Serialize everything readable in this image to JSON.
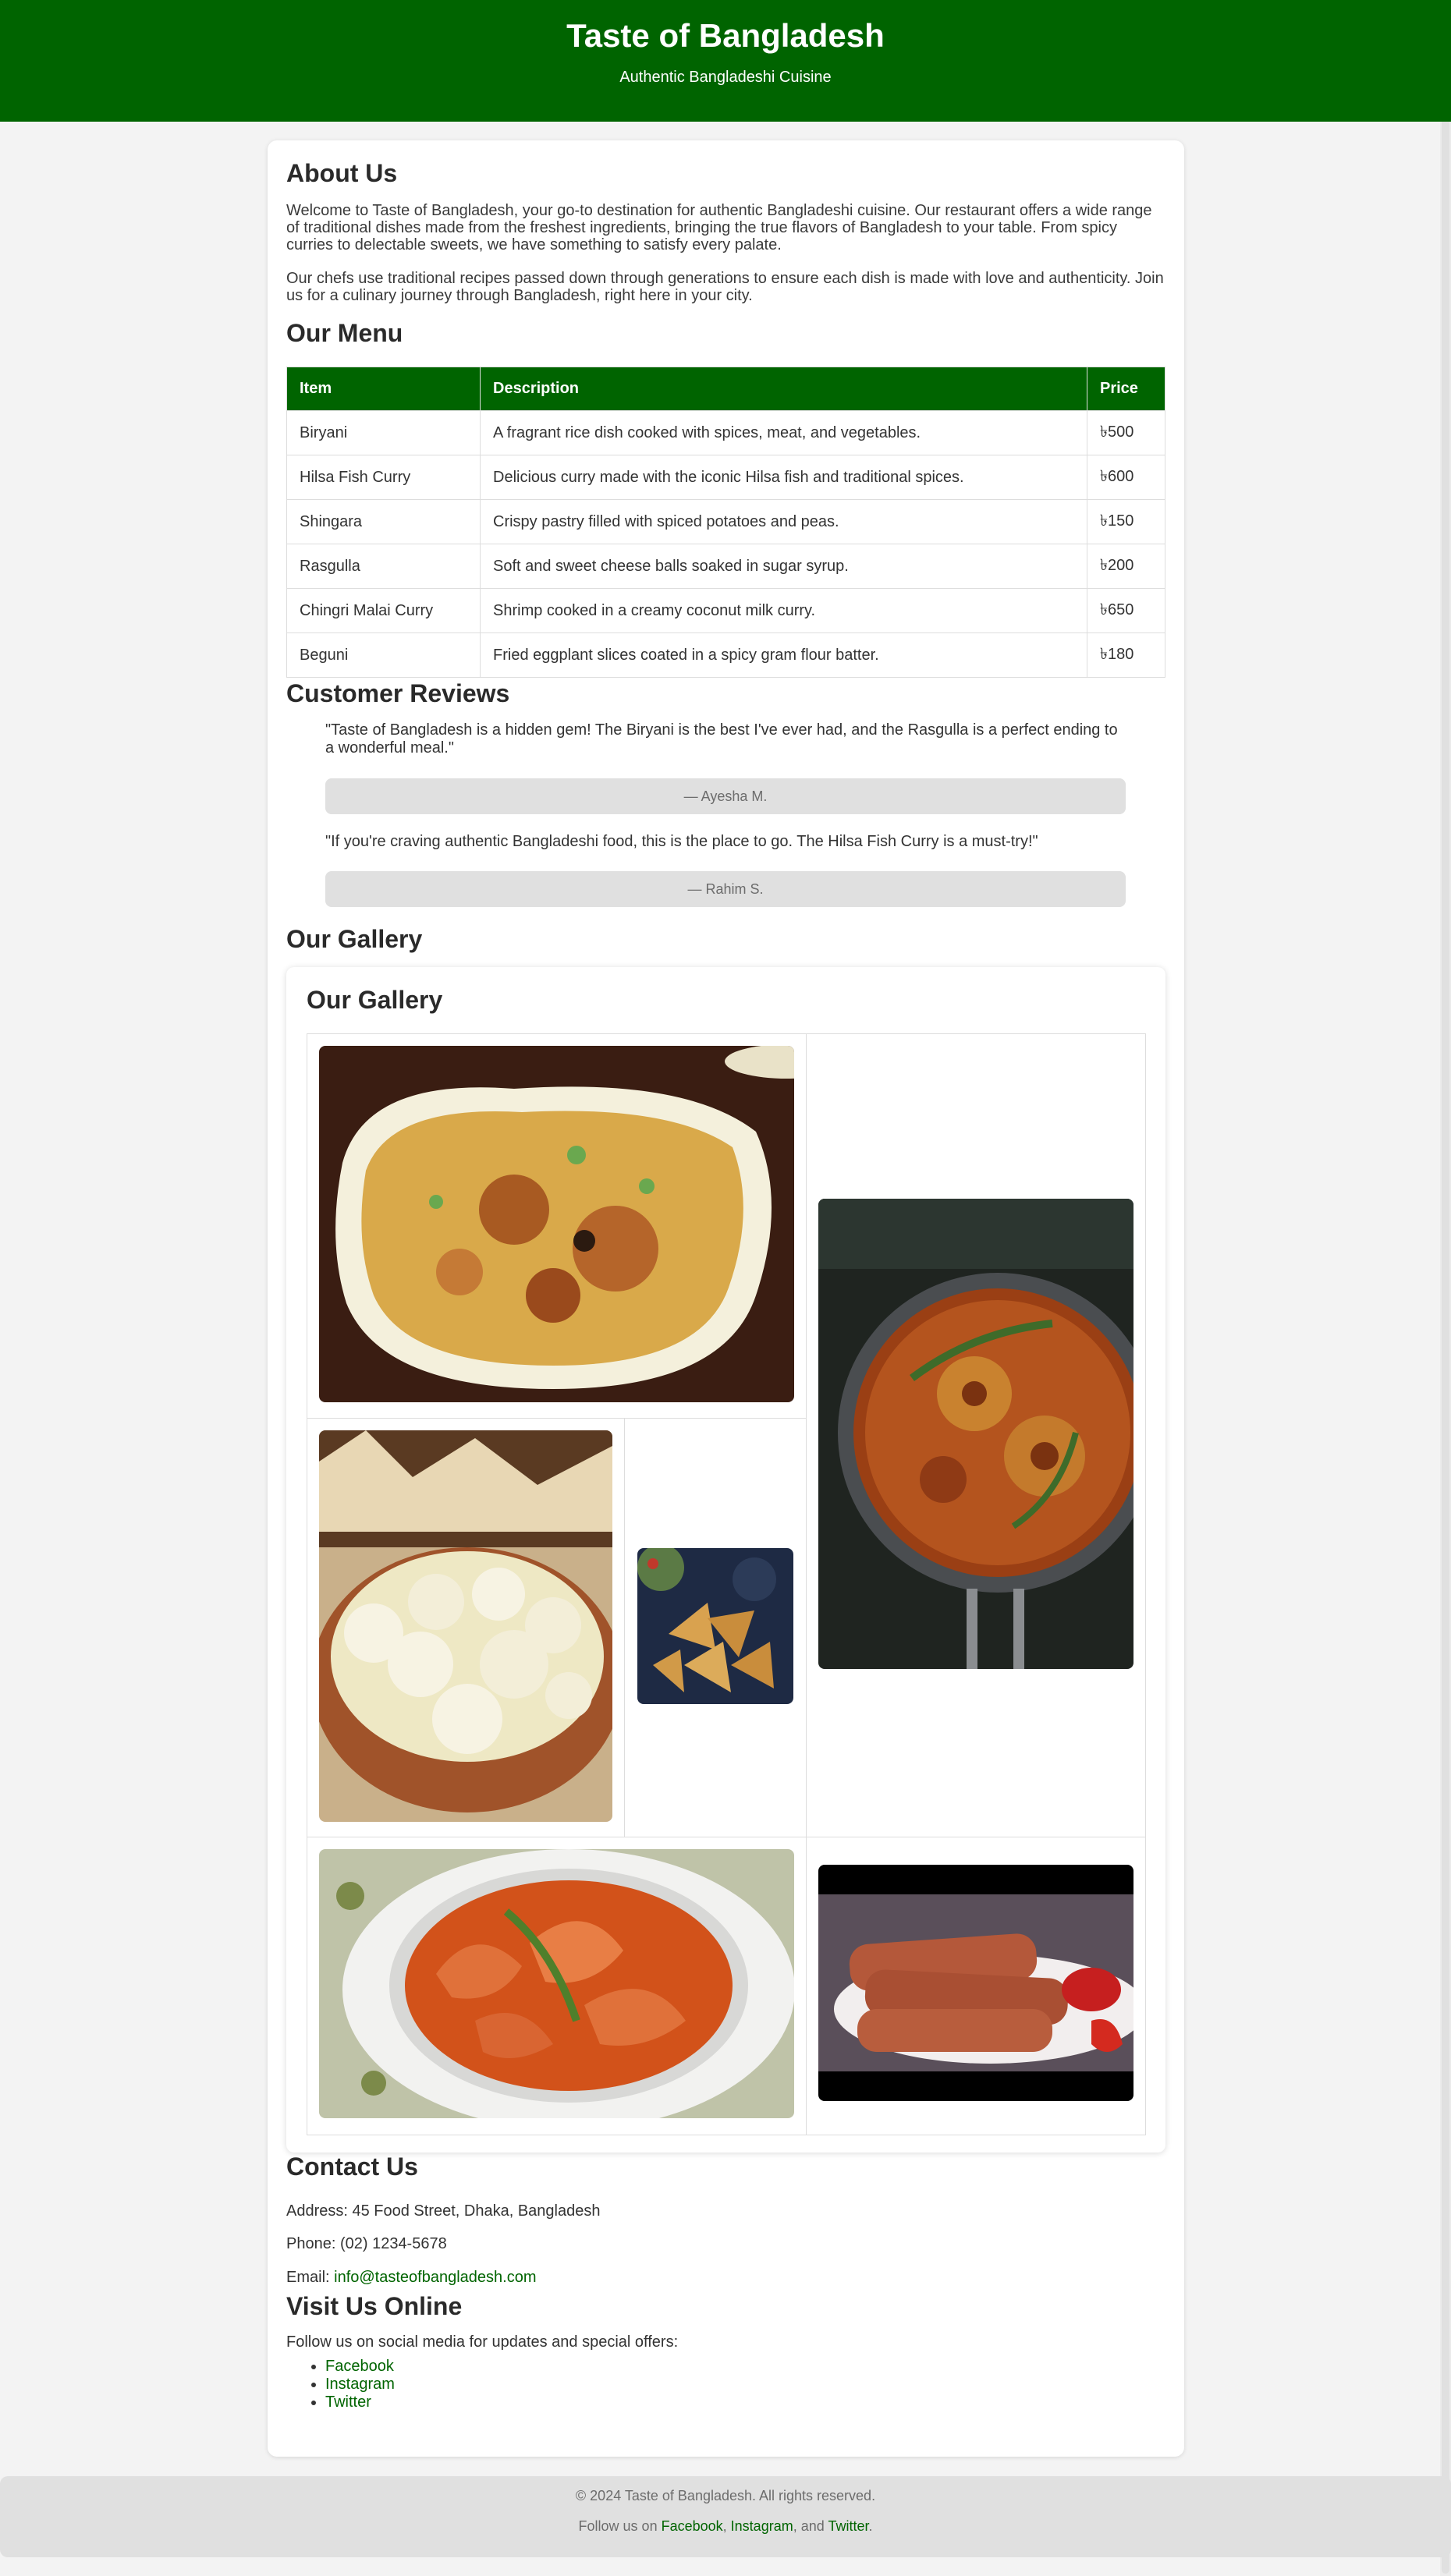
{
  "header": {
    "title": "Taste of Bangladesh",
    "tagline": "Authentic Bangladeshi Cuisine"
  },
  "about": {
    "heading": "About Us",
    "paragraph1": "Welcome to Taste of Bangladesh, your go-to destination for authentic Bangladeshi cuisine. Our restaurant offers a wide range of traditional dishes made from the freshest ingredients, bringing the true flavors of Bangladesh to your table. From spicy curries to delectable sweets, we have something to satisfy every palate.",
    "paragraph2": "Our chefs use traditional recipes passed down through generations to ensure each dish is made with love and authenticity. Join us for a culinary journey through Bangladesh, right here in your city."
  },
  "menu": {
    "heading": "Our Menu",
    "columns": [
      "Item",
      "Description",
      "Price"
    ],
    "rows": [
      [
        "Biryani",
        "A fragrant rice dish cooked with spices, meat, and vegetables.",
        "৳500"
      ],
      [
        "Hilsa Fish Curry",
        "Delicious curry made with the iconic Hilsa fish and traditional spices.",
        "৳600"
      ],
      [
        "Shingara",
        "Crispy pastry filled with spiced potatoes and peas.",
        "৳150"
      ],
      [
        "Rasgulla",
        "Soft and sweet cheese balls soaked in sugar syrup.",
        "৳200"
      ],
      [
        "Chingri Malai Curry",
        "Shrimp cooked in a creamy coconut milk curry.",
        "৳650"
      ],
      [
        "Beguni",
        "Fried eggplant slices coated in a spicy gram flour batter.",
        "৳180"
      ]
    ]
  },
  "reviews": {
    "heading": "Customer Reviews",
    "items": [
      {
        "text": "\"Taste of Bangladesh is a hidden gem! The Biryani is the best I've ever had, and the Rasgulla is a perfect ending to a wonderful meal.\"",
        "author": "— Ayesha M."
      },
      {
        "text": "\"If you're craving authentic Bangladeshi food, this is the place to go. The Hilsa Fish Curry is a must-try!\"",
        "author": "— Rahim S."
      }
    ]
  },
  "gallery": {
    "section_heading": "Our Gallery",
    "card_heading": "Our Gallery",
    "photos": [
      "biryani-photo",
      "hilsa-fish-curry-photo",
      "rasgulla-photo",
      "shingara-photo",
      "chingri-malai-curry-photo",
      "beguni-photo"
    ]
  },
  "contact": {
    "heading": "Contact Us",
    "address": "Address: 45 Food Street, Dhaka, Bangladesh",
    "phone": "Phone: (02) 1234-5678",
    "email_label": "Email: ",
    "email": "info@tasteofbangladesh.com"
  },
  "social": {
    "heading": "Visit Us Online",
    "intro": "Follow us on social media for updates and special offers:",
    "links": [
      "Facebook",
      "Instagram",
      "Twitter"
    ]
  },
  "footer": {
    "copyright": "© 2024 Taste of Bangladesh. All rights reserved.",
    "follow_prefix": "Follow us on ",
    "sep1": ", ",
    "sep2": ", and ",
    "end": ".",
    "links": [
      "Facebook",
      "Instagram",
      "Twitter"
    ]
  },
  "colors": {
    "brand_green": "#006400",
    "page_bg": "#f3f3f3",
    "footer_bg": "#e0e0e0"
  }
}
